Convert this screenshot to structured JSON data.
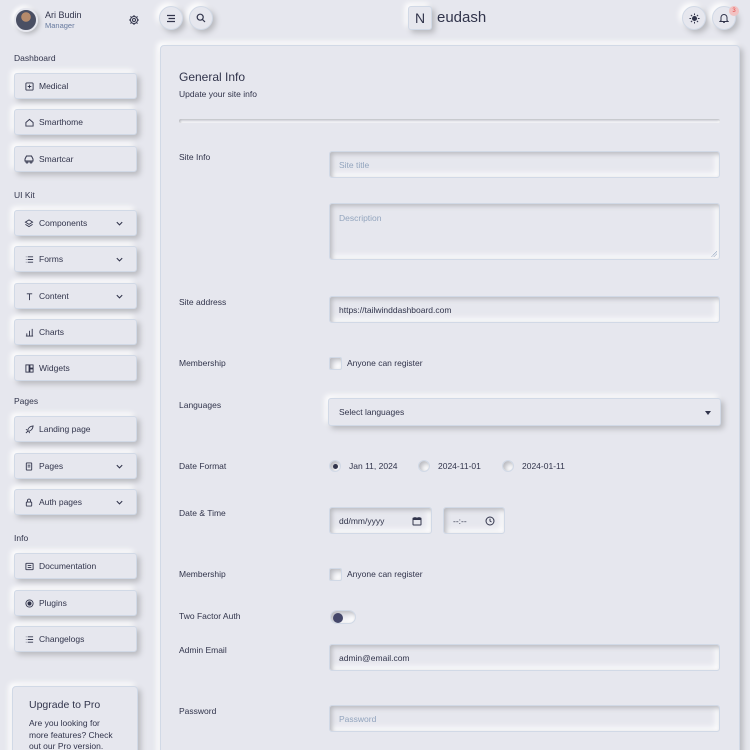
{
  "user": {
    "name": "Ari Budin",
    "role": "Manager"
  },
  "sidebar": {
    "sections": {
      "dashboard": "Dashboard",
      "ui_kit": "UI Kit",
      "pages": "Pages",
      "info": "Info"
    },
    "items": {
      "medical": "Medical",
      "smarthome": "Smarthome",
      "smartcar": "Smartcar",
      "components": "Components",
      "forms": "Forms",
      "content": "Content",
      "charts": "Charts",
      "widgets": "Widgets",
      "landing": "Landing page",
      "pages": "Pages",
      "auth": "Auth pages",
      "documentation": "Documentation",
      "plugins": "Plugins",
      "changelogs": "Changelogs"
    },
    "upgrade": {
      "title": "Upgrade to Pro",
      "text": "Are you looking for more features? Check out our Pro version."
    }
  },
  "topbar": {
    "logo_letter": "N",
    "logo_text": "eudash",
    "notification_count": "3"
  },
  "form": {
    "title": "General Info",
    "subtitle": "Update your site info",
    "labels": {
      "site_info": "Site Info",
      "site_address": "Site address",
      "membership": "Membership",
      "languages": "Languages",
      "date_format": "Date Format",
      "date_time": "Date & Time",
      "membership2": "Membership",
      "two_factor": "Two Factor Auth",
      "admin_email": "Admin Email",
      "password": "Password"
    },
    "site_title_placeholder": "Site title",
    "description_placeholder": "Description",
    "site_address_value": "https://tailwinddashboard.com",
    "membership_checkbox": "Anyone can register",
    "membership2_checkbox": "Anyone can register",
    "languages_select": "Select languages",
    "date_formats": [
      "Jan 11, 2024",
      "2024-11-01",
      "2024-01-11"
    ],
    "date_placeholder": "dd/mm/yyyy",
    "time_placeholder": "--:--",
    "admin_email_value": "admin@email.com",
    "password_placeholder": "Password"
  }
}
